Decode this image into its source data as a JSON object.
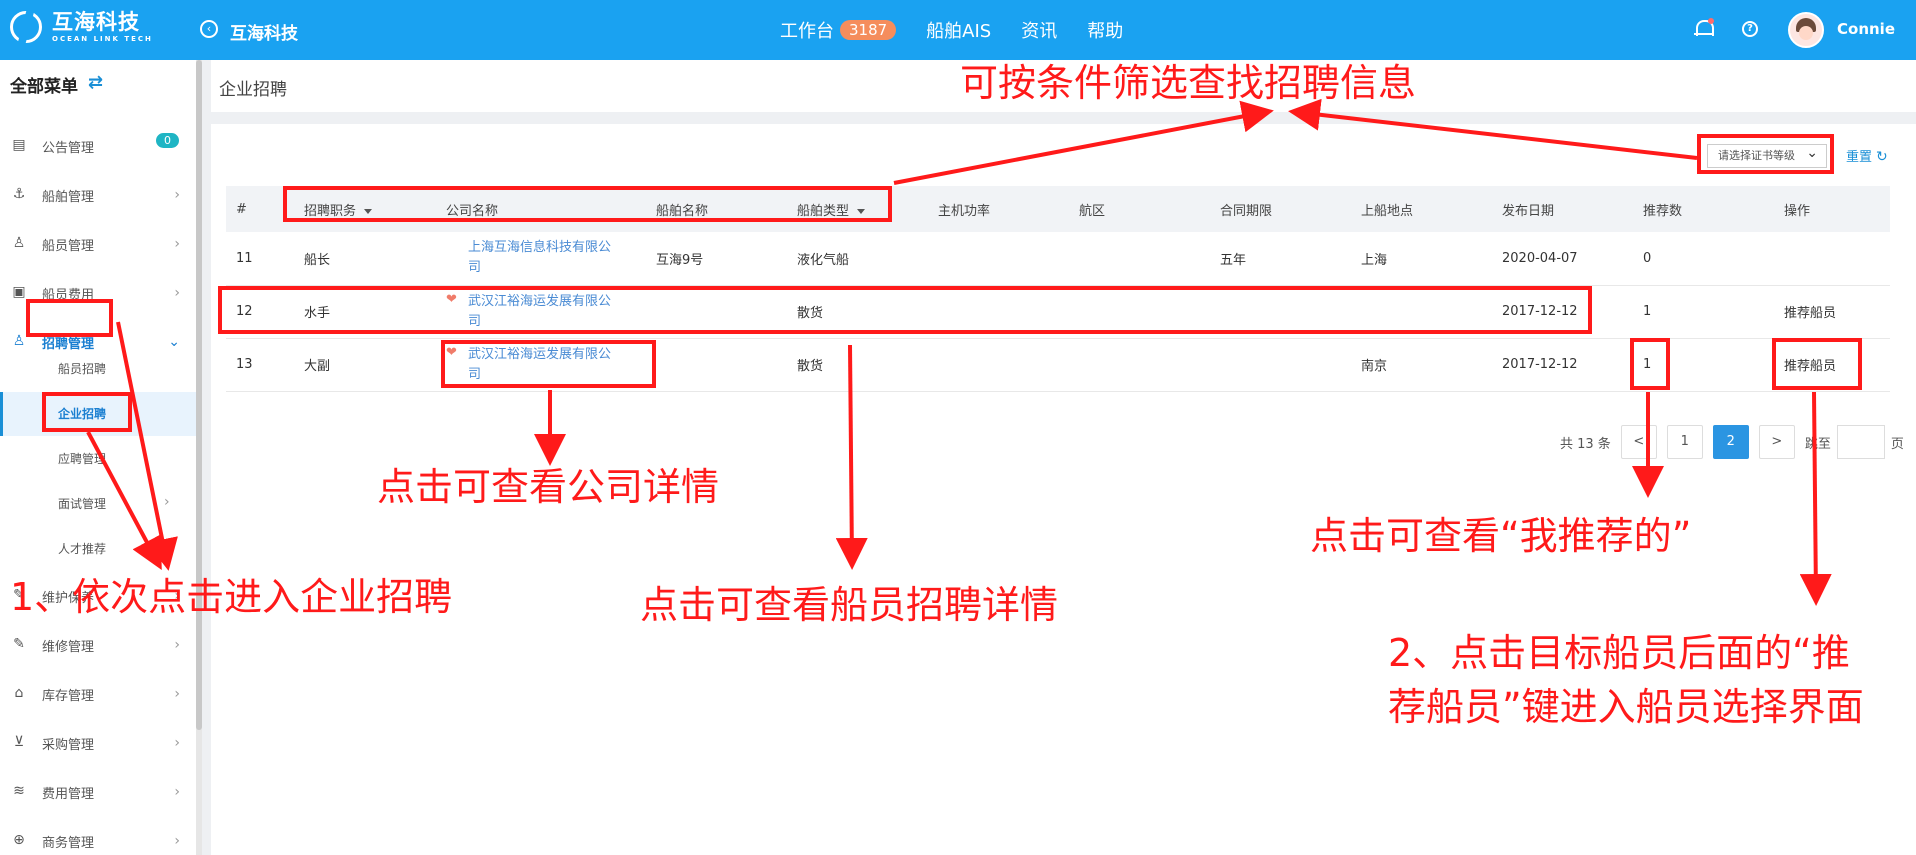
{
  "topbar": {
    "logo_cn": "互海科技",
    "logo_en": "OCEAN LINK TECH",
    "back_label": "互海科技",
    "nav": [
      {
        "label": "工作台",
        "badge": "3187"
      },
      {
        "label": "船舶AIS"
      },
      {
        "label": "资讯"
      },
      {
        "label": "帮助"
      }
    ],
    "user_name": "Connie"
  },
  "sidebar": {
    "title": "全部菜单",
    "items": [
      {
        "label": "公告管理",
        "badge": "0"
      },
      {
        "label": "船舶管理"
      },
      {
        "label": "船员管理"
      },
      {
        "label": "船员费用"
      },
      {
        "label": "招聘管理"
      },
      {
        "label": "维护保养"
      },
      {
        "label": "维修管理"
      },
      {
        "label": "库存管理"
      },
      {
        "label": "采购管理"
      },
      {
        "label": "费用管理"
      },
      {
        "label": "商务管理"
      }
    ],
    "subitems": [
      "船员招聘",
      "企业招聘",
      "应聘管理",
      "面试管理",
      "人才推荐"
    ]
  },
  "page": {
    "title": "企业招聘",
    "filter_placeholder": "请选择证书等级",
    "reset": "重置"
  },
  "table": {
    "headers": [
      "#",
      "招聘职务",
      "公司名称",
      "船舶名称",
      "船舶类型",
      "主机功率",
      "航区",
      "合同期限",
      "上船地点",
      "发布日期",
      "推荐数",
      "操作"
    ],
    "rows": [
      {
        "no": "11",
        "position": "船长",
        "company": "上海互海信息科技有限公司",
        "ship": "互海9号",
        "type": "液化气船",
        "power": "",
        "area": "",
        "term": "五年",
        "location": "上海",
        "date": "2020-04-07",
        "recommend": "0",
        "action": ""
      },
      {
        "no": "12",
        "position": "水手",
        "company": "武汉江裕海运发展有限公司",
        "ship": "",
        "type": "散货",
        "power": "",
        "area": "",
        "term": "",
        "location": "",
        "date": "2017-12-12",
        "recommend": "1",
        "action": "推荐船员"
      },
      {
        "no": "13",
        "position": "大副",
        "company": "武汉江裕海运发展有限公司",
        "ship": "",
        "type": "散货",
        "power": "",
        "area": "",
        "term": "",
        "location": "南京",
        "date": "2017-12-12",
        "recommend": "1",
        "action": "推荐船员"
      }
    ]
  },
  "pager": {
    "total": "共 13 条",
    "prev": "<",
    "pages": [
      "1",
      "2"
    ],
    "next": ">",
    "jump": "跳至",
    "page_unit": "页"
  },
  "annotations": {
    "filter": "可按条件筛选查找招聘信息",
    "company": "点击可查看公司详情",
    "crew": "点击可查看船员招聘详情",
    "my_recommend": "点击可查看“我推荐的”",
    "step1": "1、依次点击进入企业招聘",
    "step2_line1": "2、点击目标船员后面的“推",
    "step2_line2": "荐船员”键进入船员选择界面"
  }
}
